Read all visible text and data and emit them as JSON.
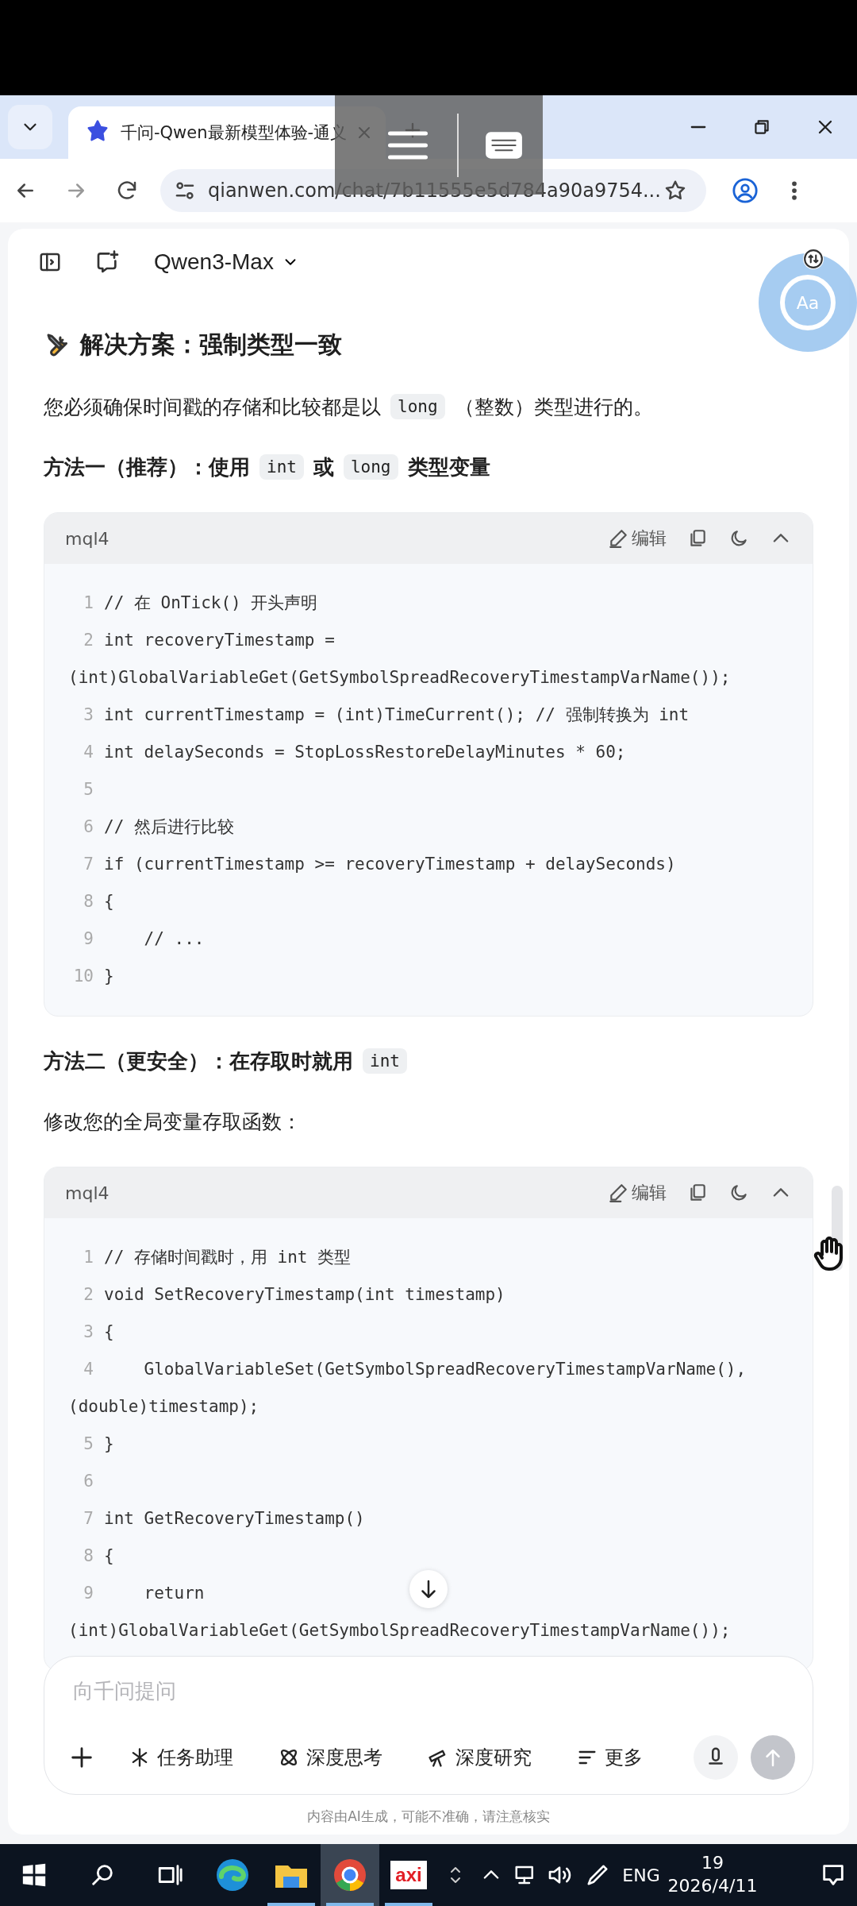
{
  "browser": {
    "tab_title": "千问-Qwen最新模型体验-通义",
    "url": "qianwen.com/chat/7b11555e5d784a90a9754..."
  },
  "chat": {
    "model": "Qwen3-Max",
    "float_label": "Aa",
    "blocks": [
      {
        "kind": "title",
        "parts": [
          {
            "kind": "text",
            "text": "解决方案：强制类型一致"
          }
        ]
      },
      {
        "kind": "paragraph",
        "parts": [
          {
            "kind": "text",
            "text": "您必须确保时间戳的存储和比较都是以"
          },
          {
            "kind": "code",
            "text": "long"
          },
          {
            "kind": "text",
            "text": "（整数）类型进行的。"
          }
        ]
      },
      {
        "kind": "heading",
        "parts": [
          {
            "kind": "text",
            "text": "方法一（推荐）：使用"
          },
          {
            "kind": "code",
            "text": "int"
          },
          {
            "kind": "text",
            "text": "或"
          },
          {
            "kind": "code",
            "text": "long"
          },
          {
            "kind": "text",
            "text": "类型变量"
          }
        ]
      },
      {
        "kind": "code",
        "language": "mql4",
        "edit_label": "编辑",
        "lines": [
          {
            "number": "1",
            "text": "// 在 OnTick() 开头声明"
          },
          {
            "number": "2",
            "text": "int recoveryTimestamp =",
            "wrapped": "(int)GlobalVariableGet(GetSymbolSpreadRecoveryTimestampVarName());"
          },
          {
            "number": "3",
            "text": "int currentTimestamp = (int)TimeCurrent(); // 强制转换为 int"
          },
          {
            "number": "4",
            "text": "int delaySeconds = StopLossRestoreDelayMinutes * 60;"
          },
          {
            "number": "5"
          },
          {
            "number": "6",
            "text": "// 然后进行比较"
          },
          {
            "number": "7",
            "text": "if (currentTimestamp >= recoveryTimestamp + delaySeconds)"
          },
          {
            "number": "8",
            "text": "{"
          },
          {
            "number": "9",
            "text": "    // ..."
          },
          {
            "number": "10",
            "text": "}"
          }
        ]
      },
      {
        "kind": "heading",
        "parts": [
          {
            "kind": "text",
            "text": "方法二（更安全）：在存取时就用"
          },
          {
            "kind": "code",
            "text": "int"
          }
        ]
      },
      {
        "kind": "paragraph",
        "parts": [
          {
            "kind": "text",
            "text": "修改您的全局变量存取函数："
          }
        ]
      },
      {
        "kind": "code",
        "language": "mql4",
        "edit_label": "编辑",
        "lines": [
          {
            "number": "1",
            "text": "// 存储时间戳时，用 int 类型"
          },
          {
            "number": "2",
            "text": "void SetRecoveryTimestamp(int timestamp)"
          },
          {
            "number": "3",
            "text": "{"
          },
          {
            "number": "4",
            "text": "    GlobalVariableSet(GetSymbolSpreadRecoveryTimestampVarName(),",
            "wrapped": "(double)timestamp);"
          },
          {
            "number": "5",
            "text": "}"
          },
          {
            "number": "6"
          },
          {
            "number": "7",
            "text": "int GetRecoveryTimestamp()"
          },
          {
            "number": "8",
            "text": "{"
          },
          {
            "number": "9",
            "text": "    return",
            "wrapped": "(int)GlobalVariableGet(GetSymbolSpreadRecoveryTimestampVarName());"
          }
        ]
      }
    ],
    "input": {
      "placeholder": "向千问提问",
      "tools": [
        {
          "label": "任务助理"
        },
        {
          "label": "深度思考"
        },
        {
          "label": "深度研究"
        },
        {
          "label": "更多"
        }
      ],
      "send_disabled": true
    },
    "disclaimer": "内容由AI生成，可能不准确，请注意核实"
  },
  "taskbar": {
    "apps": [
      {
        "kind": "edge",
        "running": false,
        "selected": false
      },
      {
        "kind": "explorer",
        "running": true,
        "selected": false
      },
      {
        "kind": "chrome",
        "running": true,
        "selected": true
      },
      {
        "kind": "axi",
        "label": "axi",
        "running": true,
        "selected": false
      }
    ],
    "language": "ENG",
    "time": "19",
    "date": "2026/4/11"
  }
}
